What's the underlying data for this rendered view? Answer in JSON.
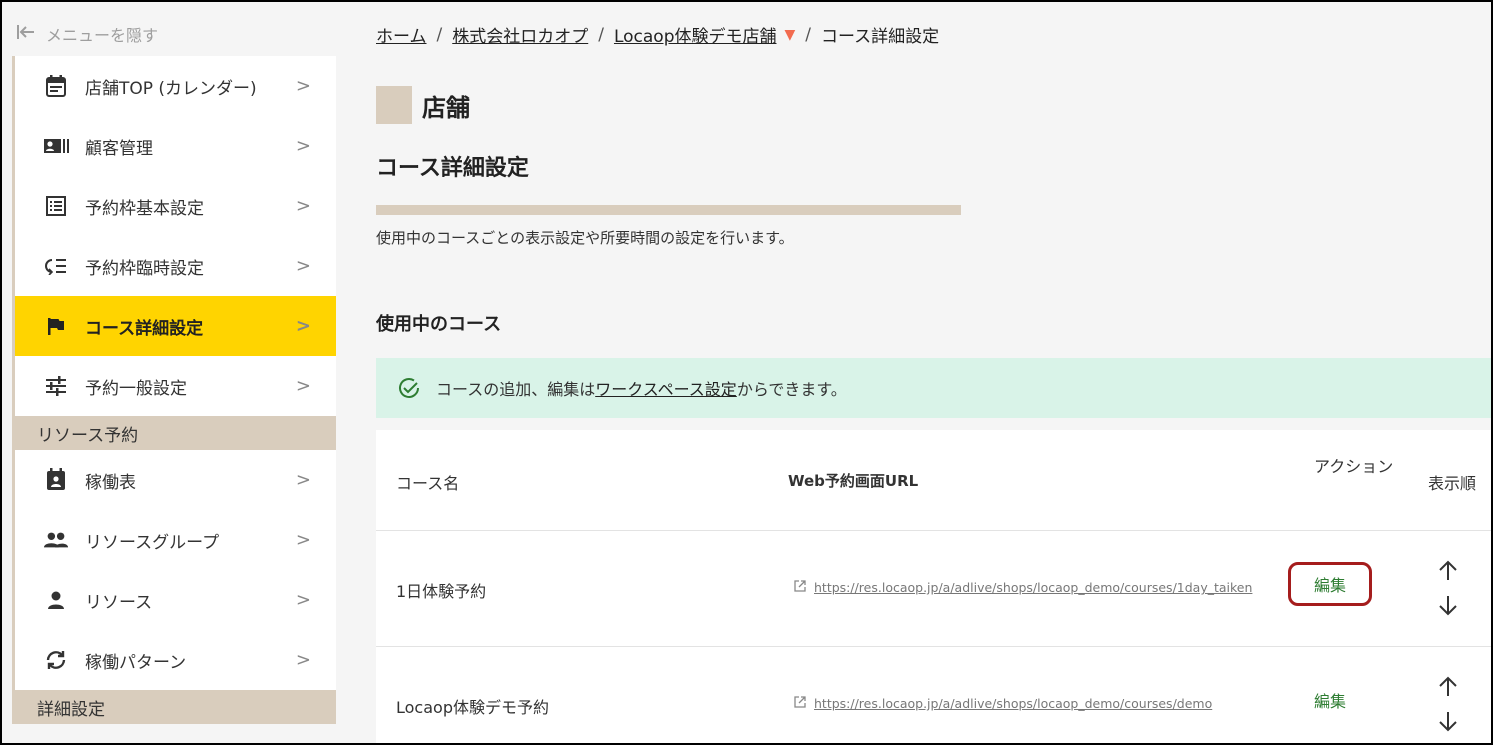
{
  "sidebar": {
    "hide_menu_label": "メニューを隠す",
    "items": [
      {
        "label": "店舗TOP (カレンダー)",
        "icon": "calendar-icon"
      },
      {
        "label": "顧客管理",
        "icon": "contact-card-icon"
      },
      {
        "label": "予約枠基本設定",
        "icon": "list-box-icon"
      },
      {
        "label": "予約枠臨時設定",
        "icon": "temporary-list-icon"
      },
      {
        "label": "コース詳細設定",
        "icon": "flag-icon",
        "active": true
      },
      {
        "label": "予約一般設定",
        "icon": "sliders-icon"
      }
    ],
    "section_resource": "リソース予約",
    "resource_items": [
      {
        "label": "稼働表",
        "icon": "schedule-icon"
      },
      {
        "label": "リソースグループ",
        "icon": "group-icon"
      },
      {
        "label": "リソース",
        "icon": "person-icon"
      },
      {
        "label": "稼働パターン",
        "icon": "sync-icon"
      }
    ],
    "section_detail": "詳細設定",
    "chevron": ">"
  },
  "breadcrumb": {
    "home": "ホーム",
    "company": "株式会社ロカオプ",
    "shop": "Locaop体験デモ店舗",
    "current": "コース詳細設定",
    "sep": "/"
  },
  "store_title": "店舗",
  "page_title": "コース詳細設定",
  "page_desc": "使用中のコースごとの表示設定や所要時間の設定を行います。",
  "section_title": "使用中のコース",
  "notice": {
    "prefix": "コースの追加、編集は",
    "link": "ワークスペース設定",
    "suffix": "からできます。"
  },
  "table": {
    "headers": {
      "name": "コース名",
      "url": "Web予約画面URL",
      "action": "アクション",
      "order": "表示順"
    },
    "rows": [
      {
        "name": "1日体験予約",
        "url": "https://res.locaop.jp/a/adlive/shops/locaop_demo/courses/1day_taiken",
        "action": "編集"
      },
      {
        "name": "Locaop体験デモ予約",
        "url": "https://res.locaop.jp/a/adlive/shops/locaop_demo/courses/demo",
        "action": "編集"
      }
    ]
  },
  "colors": {
    "accent_yellow": "#ffd400",
    "beige": "#d9cdbd",
    "notice_bg": "#d9f3e8",
    "edit_green": "#2e7d32",
    "highlight_red": "#a51d1d"
  }
}
